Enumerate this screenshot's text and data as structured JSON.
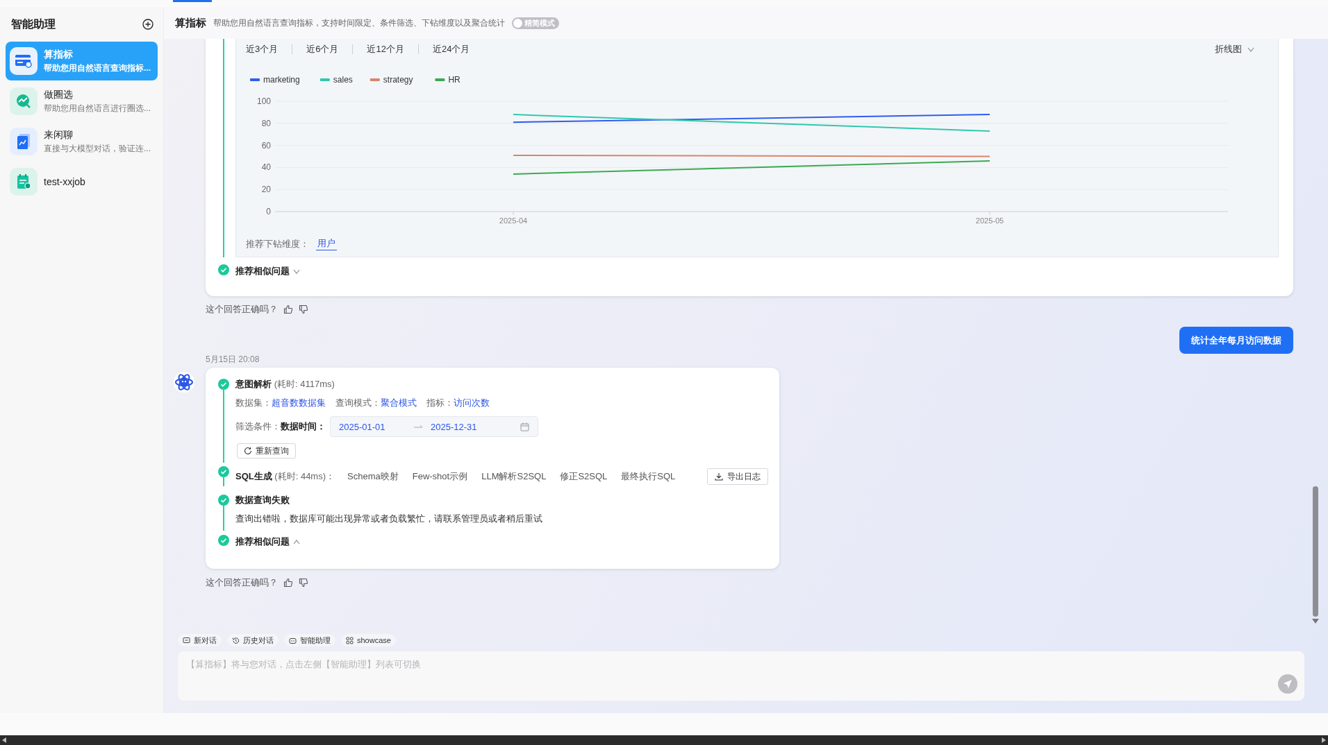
{
  "sidebar": {
    "title": "智能助理",
    "items": [
      {
        "name": "算指标",
        "description": "帮助您用自然语言查询指标...",
        "kind": "card",
        "selected": true
      },
      {
        "name": "做圈选",
        "description": "帮助您用自然语言进行圈选...",
        "kind": "trend",
        "selected": false
      },
      {
        "name": "来闲聊",
        "description": "直接与大模型对话，验证连...",
        "kind": "report",
        "selected": false
      },
      {
        "name": "test-xxjob",
        "kind": "notepad",
        "selected": false
      }
    ]
  },
  "header": {
    "title": "算指标",
    "description": "帮助您用自然语言查询指标，支持时间限定、条件筛选、下钻维度以及聚合统计",
    "toggle": {
      "label": "精简模式",
      "on": false
    }
  },
  "chart_card": {
    "time_ranges": [
      "近3个月",
      "近6个月",
      "近12个月",
      "近24个月"
    ],
    "chart_type": "折线图",
    "chart_data": {
      "type": "line",
      "legend": "top",
      "grid": true,
      "categories": [
        "2025-04",
        "2025-05"
      ],
      "ylim": [
        0,
        100
      ],
      "yticks": [
        0,
        20,
        40,
        60,
        80,
        100
      ],
      "series": [
        {
          "name": "marketing",
          "color": "#2f5cf0",
          "values": [
            81,
            88
          ]
        },
        {
          "name": "sales",
          "color": "#2ec9ad",
          "values": [
            88,
            73
          ]
        },
        {
          "name": "strategy",
          "color": "#d9856b",
          "values": [
            51,
            50
          ]
        },
        {
          "name": "HR",
          "color": "#3aaa4f",
          "values": [
            34,
            46
          ]
        }
      ]
    },
    "drill_label": "推荐下钻维度：",
    "drill_value": "用户",
    "similar": {
      "label": "推荐相似问题",
      "expanded": false
    },
    "feedback": "这个回答正确吗？"
  },
  "user_message": "统计全年每月访问数据",
  "answer": {
    "time": "5月15日 20:08",
    "intent": {
      "title": "意图解析",
      "timing": "(耗时: 4117ms)",
      "fields": [
        {
          "label": "数据集：",
          "value": "超音数数据集"
        },
        {
          "label": "查询模式：",
          "value": "聚合模式"
        },
        {
          "label": "指标：",
          "value": "访问次数"
        }
      ],
      "filter_label": "筛选条件：",
      "filter_field": "数据时间：",
      "start_date": "2025-01-01",
      "end_date": "2025-12-31",
      "requery": "重新查询"
    },
    "sql": {
      "title": "SQL生成",
      "timing": "(耗时: 44ms)：",
      "tabs": [
        "Schema映射",
        "Few-shot示例",
        "LLM解析S2SQL",
        "修正S2SQL",
        "最终执行SQL"
      ],
      "export": "导出日志"
    },
    "result": {
      "title": "数据查询失败",
      "message": "查询出错啦，数据库可能出现异常或者负载繁忙，请联系管理员或者稍后重试"
    },
    "similar": {
      "label": "推荐相似问题",
      "expanded": true
    },
    "feedback": "这个回答正确吗？"
  },
  "toolbar": [
    {
      "label": "新对话",
      "kind": "chat"
    },
    {
      "label": "历史对话",
      "kind": "history"
    },
    {
      "label": "智能助理",
      "kind": "robot"
    },
    {
      "label": "showcase",
      "kind": "grid"
    }
  ],
  "input": {
    "placeholder": "【算指标】将与您对话，点击左侧【智能助理】列表可切换"
  }
}
